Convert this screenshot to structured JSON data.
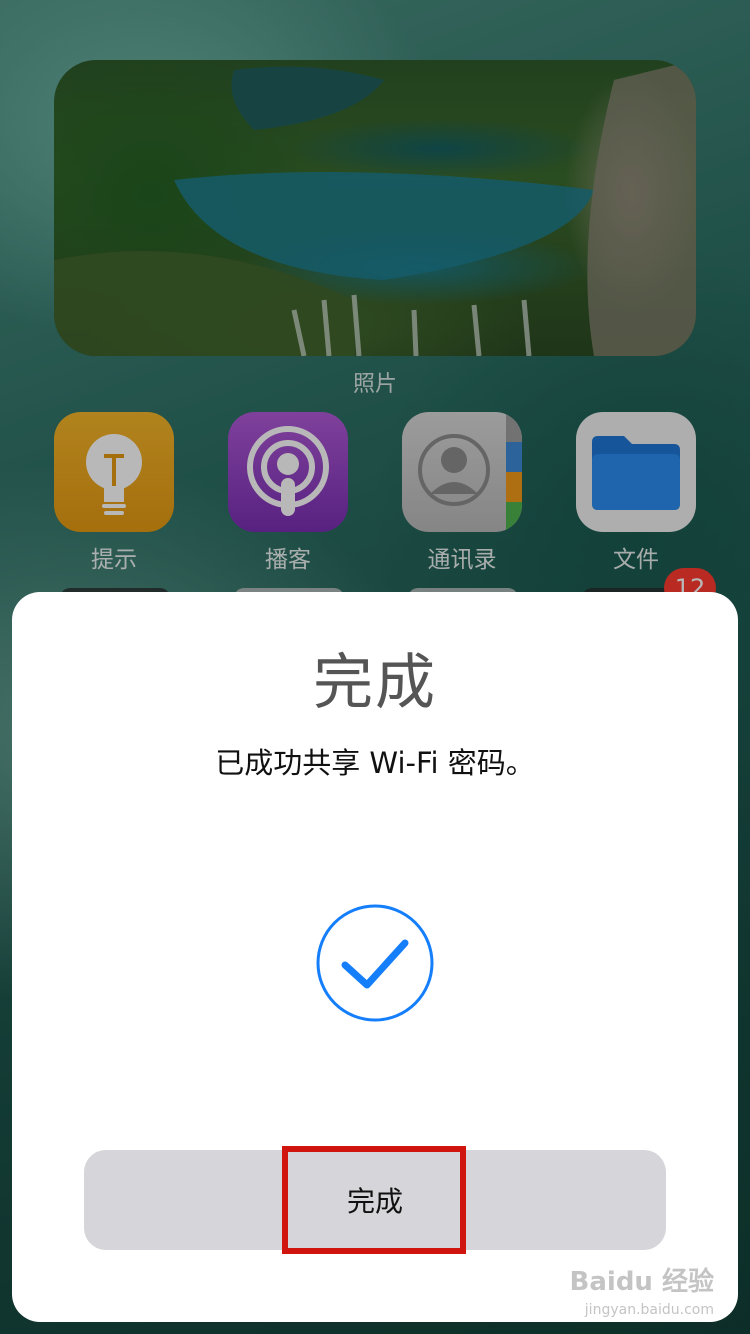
{
  "widget": {
    "label": "照片",
    "image": "waterfall-lake-photo"
  },
  "apps": [
    {
      "label": "提示",
      "icon": "tips-lightbulb-icon"
    },
    {
      "label": "播客",
      "icon": "podcasts-icon"
    },
    {
      "label": "通讯录",
      "icon": "contacts-icon"
    },
    {
      "label": "文件",
      "icon": "files-folder-icon"
    }
  ],
  "badge": "12",
  "dialog": {
    "title": "完成",
    "message": "已成功共享 Wi-Fi 密码。",
    "status_icon": "checkmark-circle-icon",
    "done_button": "完成"
  },
  "watermark": {
    "brand": "Baidu 经验",
    "url": "jingyan.baidu.com"
  },
  "colors": {
    "accent": "#147EFB",
    "highlight": "#D0150F",
    "button_bg": "#D6D6DA"
  }
}
